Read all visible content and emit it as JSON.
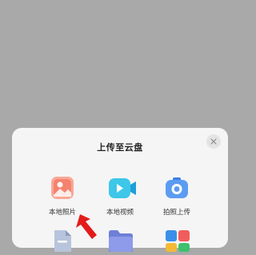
{
  "dialog": {
    "title": "上传至云盘",
    "items": [
      {
        "label": "本地照片",
        "icon": "photo-icon"
      },
      {
        "label": "本地视频",
        "icon": "video-icon"
      },
      {
        "label": "拍照上传",
        "icon": "camera-icon"
      }
    ],
    "row2_icons": [
      "document-icon",
      "folder-icon",
      "app-icon"
    ]
  },
  "colors": {
    "overlay": "#a9a9a9",
    "sheet": "#f5f5f5",
    "photo_icon": "#f4826f",
    "video_icon": "#3ec7e8",
    "camera_icon": "#5b9cf2",
    "arrow": "#e31b1b"
  }
}
